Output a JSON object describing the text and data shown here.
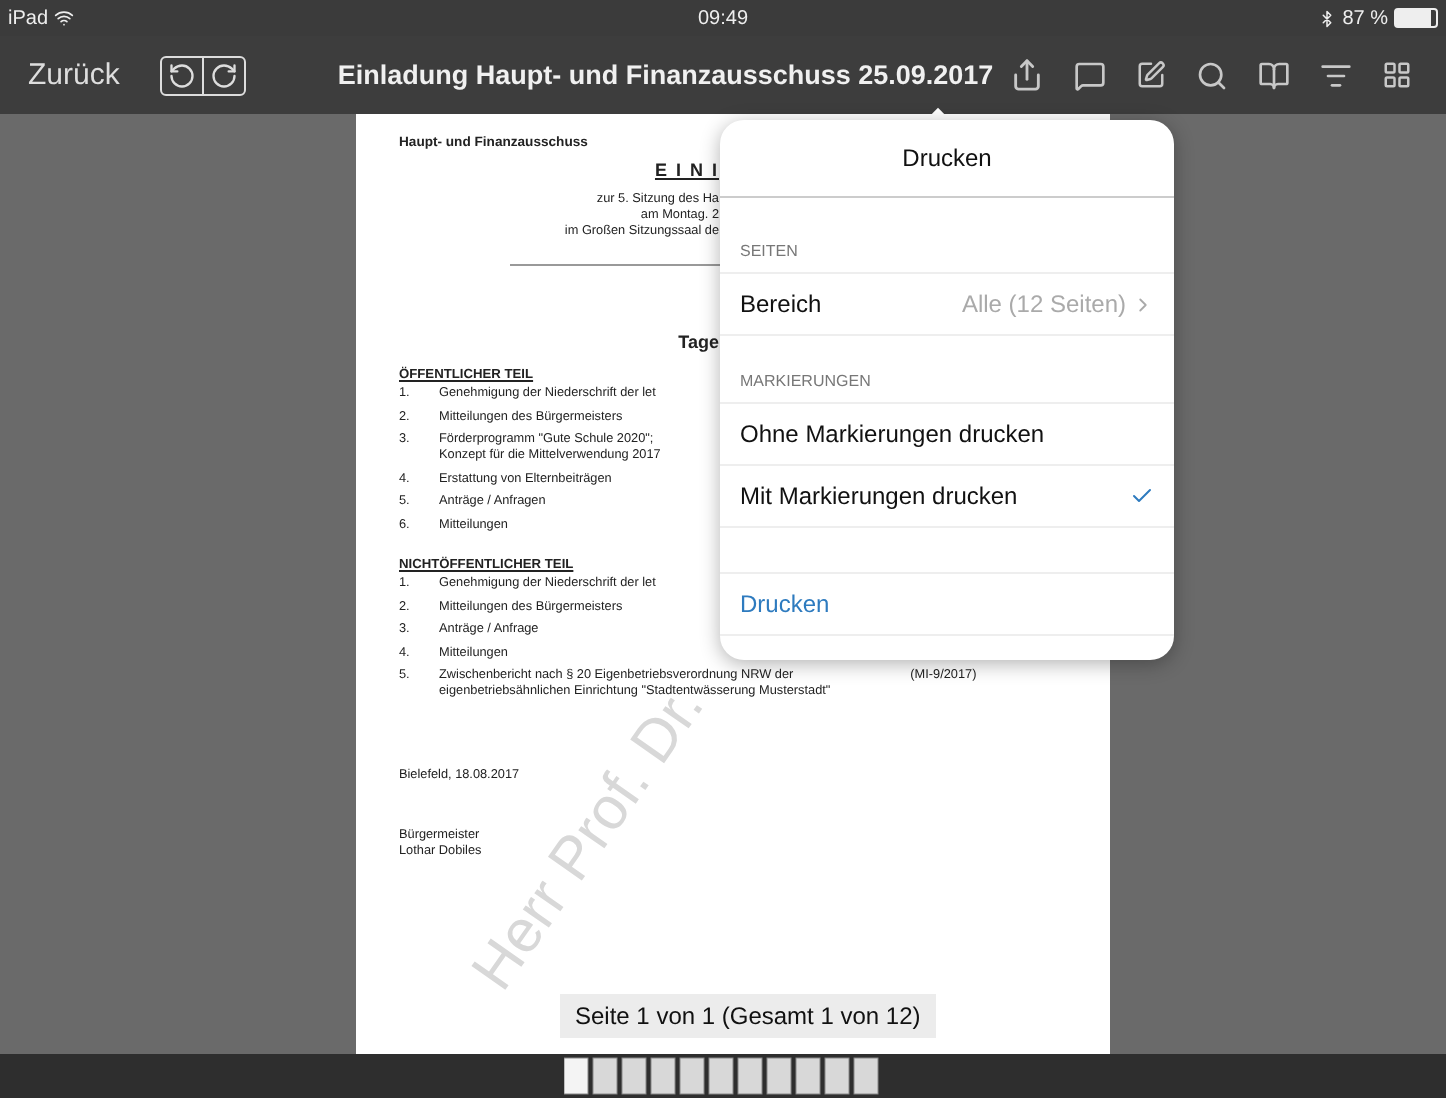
{
  "status_bar": {
    "device": "iPad",
    "time": "09:49",
    "battery": "87 %"
  },
  "toolbar": {
    "back": "Zurück",
    "title": "Einladung Haupt- und Finanzausschuss 25.09.2017"
  },
  "document": {
    "committee": "Haupt- und Finanzausschuss",
    "heading": "E I N I",
    "intro_lines": [
      "zur 5. Sitzung des Ha",
      "am Montag. 2",
      "im Großen Sitzungssaal de"
    ],
    "agenda_title": "Tage",
    "sections": [
      {
        "title": "ÖFFENTLICHER TEIL",
        "items": [
          {
            "number": "1.",
            "lines": [
              "Genehmigung der Niederschrift der let"
            ]
          },
          {
            "number": "2.",
            "lines": [
              "Mitteilungen des Bürgermeisters"
            ]
          },
          {
            "number": "3.",
            "lines": [
              "Förderprogramm \"Gute Schule 2020\";",
              "Konzept für die Mittelverwendung 2017"
            ]
          },
          {
            "number": "4.",
            "lines": [
              "Erstattung von Elternbeiträgen"
            ]
          },
          {
            "number": "5.",
            "lines": [
              "Anträge / Anfragen"
            ]
          },
          {
            "number": "6.",
            "lines": [
              "Mitteilungen"
            ]
          }
        ]
      },
      {
        "title": "NICHTÖFFENTLICHER TEIL",
        "items": [
          {
            "number": "1.",
            "lines": [
              "Genehmigung der Niederschrift der let"
            ]
          },
          {
            "number": "2.",
            "lines": [
              "Mitteilungen des Bürgermeisters"
            ]
          },
          {
            "number": "3.",
            "lines": [
              "Anträge / Anfrage"
            ]
          },
          {
            "number": "4.",
            "lines": [
              "Mitteilungen"
            ]
          },
          {
            "number": "5.",
            "lines": [
              "Zwischenbericht nach § 20 Eigenbetriebsverordnung NRW der",
              "eigenbetriebsähnlichen Einrichtung \"Stadtentwässerung Musterstadt\""
            ],
            "ref": "(MI-9/2017)"
          }
        ]
      }
    ],
    "place_date": "Bielefeld, 18.08.2017",
    "signature_lines": [
      "Bürgermeister",
      "Lothar Dobiles"
    ],
    "watermark": "Herr Prof. Dr."
  },
  "page_indicator": "Seite 1 von 1 (Gesamt 1 von 12)",
  "popover": {
    "title": "Drucken",
    "sections": [
      {
        "header": "SEITEN",
        "rows": [
          {
            "kind": "value",
            "label": "Bereich",
            "value": "Alle (12 Seiten)"
          }
        ]
      },
      {
        "header": "MARKIERUNGEN",
        "rows": [
          {
            "kind": "option",
            "label": "Ohne Markierungen drucken",
            "selected": false
          },
          {
            "kind": "option",
            "label": "Mit Markierungen drucken",
            "selected": true
          }
        ]
      }
    ],
    "action": "Drucken"
  }
}
